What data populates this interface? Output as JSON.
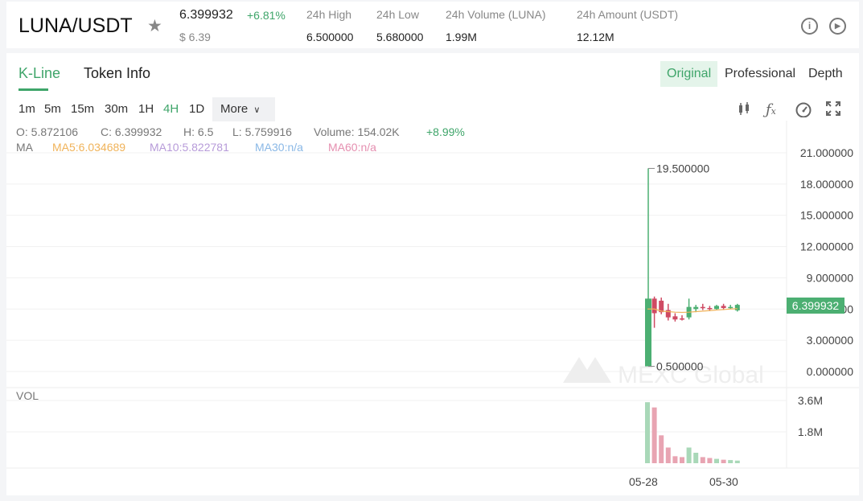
{
  "header": {
    "pair": "LUNA/USDT",
    "price": "6.399932",
    "change": "+6.81%",
    "usd_price": "$ 6.39",
    "stats": [
      {
        "label": "24h High",
        "value": "6.500000"
      },
      {
        "label": "24h Low",
        "value": "5.680000"
      },
      {
        "label": "24h Volume (LUNA)",
        "value": "1.99M"
      },
      {
        "label": "24h Amount (USDT)",
        "value": "12.12M"
      }
    ],
    "info_glyph": "i",
    "play_glyph": "▶"
  },
  "tabs": [
    "K-Line",
    "Token Info"
  ],
  "views": [
    "Original",
    "Professional",
    "Depth"
  ],
  "timeframes": [
    "1m",
    "5m",
    "15m",
    "30m",
    "1H",
    "4H",
    "1D"
  ],
  "active_timeframe": "4H",
  "more_label": "More",
  "ohlc": {
    "o": "O: 5.872106",
    "c": "C: 6.399932",
    "h": "H: 6.5",
    "l": "L: 5.759916",
    "volume": "Volume: 154.02K",
    "change": "+8.99%"
  },
  "ma": {
    "label": "MA",
    "ma5": "MA5:6.034689",
    "ma10": "MA10:5.822781",
    "ma30": "MA30:n/a",
    "ma60": "MA60:n/a"
  },
  "colors": {
    "up": "#4caf72",
    "down": "#cf4a63",
    "ma5": "#f0b35a",
    "ma10": "#b79bd9",
    "ma30": "#8ab8e6",
    "ma60": "#e58fb0"
  },
  "watermark": "MEXC Global",
  "chart_data": {
    "type": "candlestick",
    "price_ticks": [
      "21.000000",
      "18.000000",
      "15.000000",
      "12.000000",
      "9.000000",
      "6.000000",
      "3.000000",
      "0.000000"
    ],
    "volume_label": "VOL",
    "volume_ticks": [
      "3.6M",
      "1.8M"
    ],
    "x_ticks": [
      "05-28",
      "05-30"
    ],
    "last_price": "6.399932",
    "high_marker": "19.500000",
    "low_marker": "0.500000",
    "ylim": [
      0,
      21
    ],
    "vol_max": 3.6,
    "candles": [
      {
        "o": 0.5,
        "h": 19.5,
        "c": 7.0,
        "l": 0.5,
        "v": 3.5
      },
      {
        "o": 7.0,
        "h": 7.2,
        "c": 5.6,
        "l": 4.2,
        "v": 3.2
      },
      {
        "o": 6.8,
        "h": 7.1,
        "c": 5.7,
        "l": 5.5,
        "v": 1.6
      },
      {
        "o": 5.9,
        "h": 6.5,
        "c": 5.2,
        "l": 4.9,
        "v": 0.9
      },
      {
        "o": 5.3,
        "h": 5.6,
        "c": 5.0,
        "l": 4.8,
        "v": 0.4
      },
      {
        "o": 5.1,
        "h": 5.4,
        "c": 5.0,
        "l": 4.9,
        "v": 0.35
      },
      {
        "o": 5.2,
        "h": 7.0,
        "c": 6.2,
        "l": 5.0,
        "v": 0.9
      },
      {
        "o": 6.0,
        "h": 6.4,
        "c": 6.2,
        "l": 5.7,
        "v": 0.6
      },
      {
        "o": 6.2,
        "h": 6.5,
        "c": 6.1,
        "l": 5.9,
        "v": 0.35
      },
      {
        "o": 6.1,
        "h": 6.3,
        "c": 6.0,
        "l": 5.8,
        "v": 0.3
      },
      {
        "o": 6.0,
        "h": 6.4,
        "c": 6.3,
        "l": 5.9,
        "v": 0.25
      },
      {
        "o": 6.3,
        "h": 6.5,
        "c": 6.1,
        "l": 5.9,
        "v": 0.2
      },
      {
        "o": 6.1,
        "h": 6.4,
        "c": 6.2,
        "l": 6.0,
        "v": 0.18
      },
      {
        "o": 5.87,
        "h": 6.5,
        "c": 6.4,
        "l": 5.76,
        "v": 0.15
      }
    ],
    "ma_line": [
      6.0,
      6.0,
      5.8,
      5.75,
      5.7,
      5.68,
      5.7,
      5.75,
      5.8,
      5.85,
      5.9,
      5.95,
      6.0,
      6.03
    ]
  }
}
